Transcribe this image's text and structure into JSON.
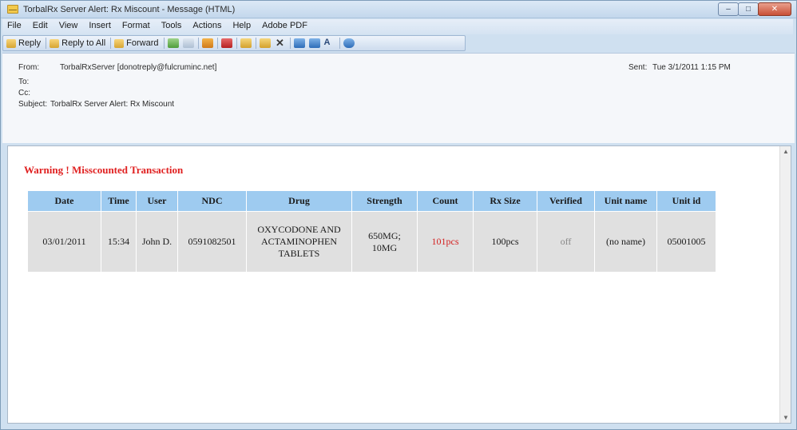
{
  "window": {
    "title": "TorbalRx Server Alert: Rx Miscount - Message (HTML)",
    "controls": [
      "–",
      "□",
      "✕"
    ]
  },
  "menu": [
    "File",
    "Edit",
    "View",
    "Insert",
    "Format",
    "Tools",
    "Actions",
    "Help",
    "Adobe PDF"
  ],
  "toolbar": {
    "reply": "Reply",
    "reply_all": "Reply to All",
    "forward": "Forward"
  },
  "header": {
    "from_label": "From:",
    "from_value": "TorbalRxServer [donotreply@fulcruminc.net]",
    "sent_label": "Sent:",
    "sent_value": "Tue 3/1/2011 1:15 PM",
    "to_label": "To:",
    "cc_label": "Cc:",
    "subject_label": "Subject:",
    "subject_value": "TorbalRx Server Alert: Rx Miscount"
  },
  "body": {
    "warning": "Warning ! Misscounted Transaction",
    "table": {
      "columns": [
        "Date",
        "Time",
        "User",
        "NDC",
        "Drug",
        "Strength",
        "Count",
        "Rx Size",
        "Verified",
        "Unit name",
        "Unit id"
      ],
      "rows": [
        [
          "03/01/2011",
          "15:34",
          "John D.",
          "0591082501",
          "OXYCODONE AND ACTAMINOPHEN TABLETS",
          "650MG; 10MG",
          "101pcs",
          "100pcs",
          "off",
          "(no name)",
          "05001005"
        ]
      ]
    }
  },
  "colors": {
    "warning_text": "#e02020",
    "table_header_bg": "#9ecbf0",
    "table_row_bg": "#e0e0e0"
  }
}
